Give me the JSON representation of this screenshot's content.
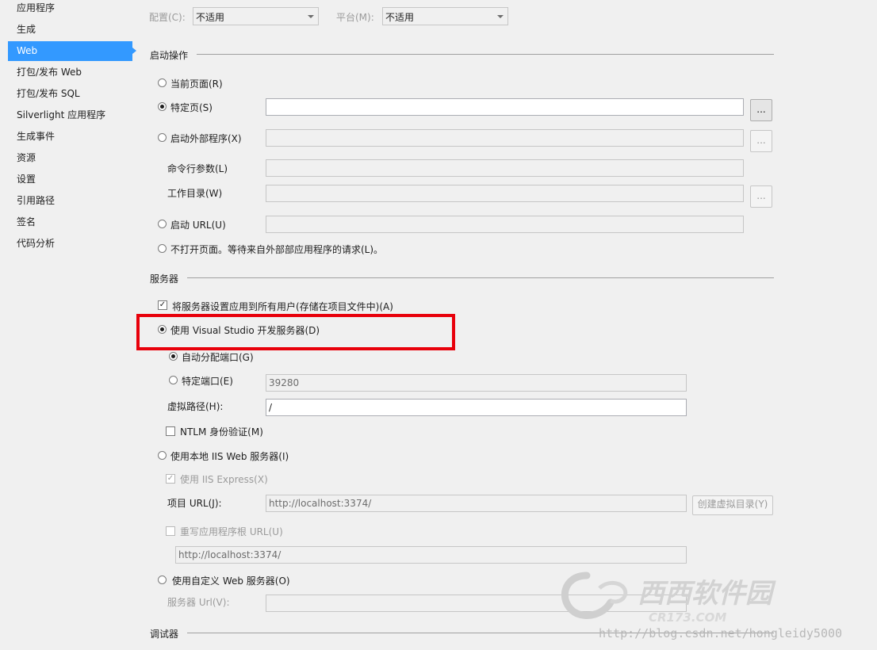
{
  "sidebar": {
    "items": [
      {
        "label": "应用程序"
      },
      {
        "label": "生成"
      },
      {
        "label": "Web"
      },
      {
        "label": "打包/发布 Web"
      },
      {
        "label": "打包/发布 SQL"
      },
      {
        "label": "Silverlight 应用程序"
      },
      {
        "label": "生成事件"
      },
      {
        "label": "资源"
      },
      {
        "label": "设置"
      },
      {
        "label": "引用路径"
      },
      {
        "label": "签名"
      },
      {
        "label": "代码分析"
      }
    ]
  },
  "top": {
    "config_label": "配置(C):",
    "config_value": "不适用",
    "platform_label": "平台(M):",
    "platform_value": "不适用"
  },
  "start_action": {
    "title": "启动操作",
    "current_page": "当前页面(R)",
    "specific_page": "特定页(S)",
    "specific_page_value": "",
    "browse_label": "...",
    "external_program": "启动外部程序(X)",
    "cmd_args": "命令行参数(L)",
    "working_dir": "工作目录(W)",
    "start_url": "启动 URL(U)",
    "dont_open": "不打开页面。等待来自外部部应用程序的请求(L)。"
  },
  "servers": {
    "title": "服务器",
    "apply_all_users": "将服务器设置应用到所有用户(存储在项目文件中)(A)",
    "use_vs_dev_server": "使用 Visual Studio 开发服务器(D)",
    "auto_assign_port": "自动分配端口(G)",
    "specific_port": "特定端口(E)",
    "specific_port_value": "39280",
    "virtual_path": "虚拟路径(H):",
    "virtual_path_value": "/",
    "ntlm_auth": "NTLM 身份验证(M)",
    "use_local_iis": "使用本地 IIS Web 服务器(I)",
    "use_iis_express": "使用 IIS Express(X)",
    "project_url": "项目 URL(J):",
    "project_url_value": "http://localhost:3374/",
    "create_vdir": "创建虚拟目录(Y)",
    "override_root": "重写应用程序根 URL(U)",
    "override_root_value": "http://localhost:3374/",
    "use_custom_server": "使用自定义 Web 服务器(O)",
    "server_url": "服务器 Url(V):",
    "server_url_value": ""
  },
  "debugger": {
    "title": "调试器"
  },
  "watermark": {
    "logo_text": "西西软件园",
    "logo_sub": "CR173.COM",
    "url": "http://blog.csdn.net/hongleidy5000"
  },
  "colors": {
    "selection": "#3399ff",
    "highlight_box": "#e8000b",
    "background": "#f0f0f0"
  }
}
